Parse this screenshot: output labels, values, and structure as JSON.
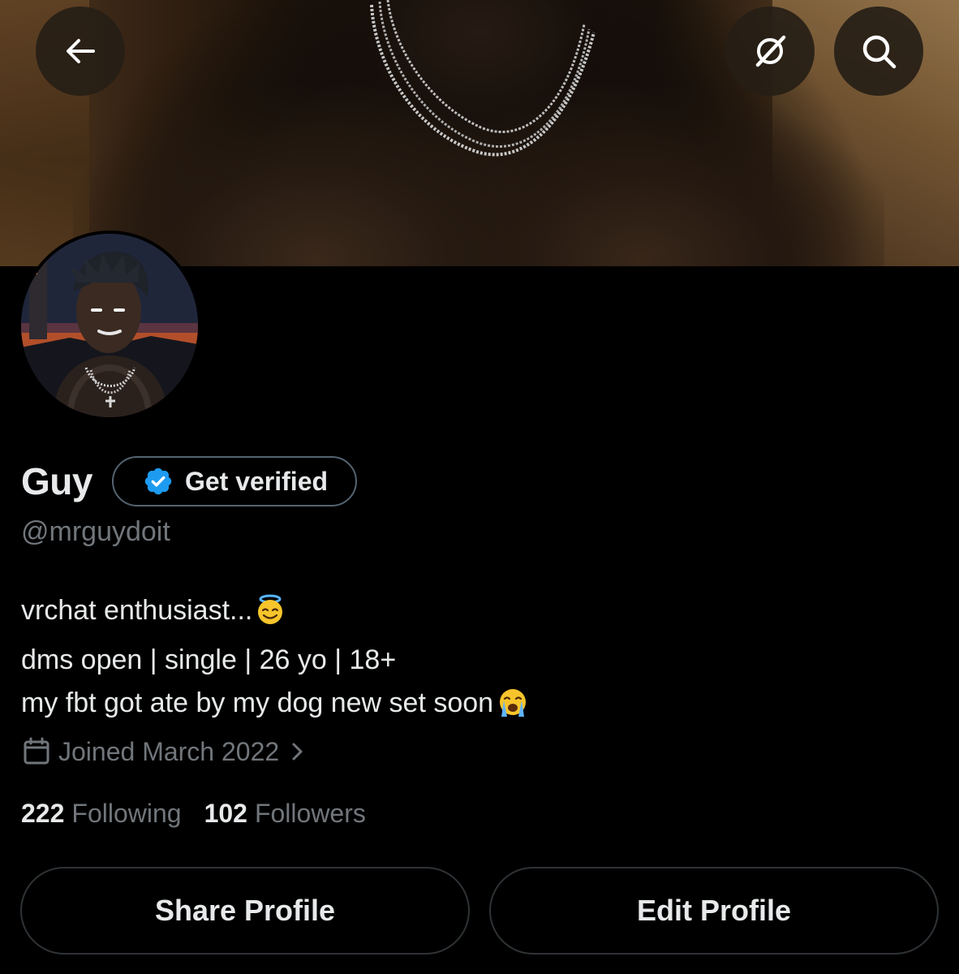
{
  "header": {
    "back_icon": "arrow-left-icon",
    "grok_icon": "grok-icon",
    "search_icon": "search-icon"
  },
  "profile": {
    "display_name": "Guy",
    "verify_label": "Get verified",
    "verify_icon": "verified-badge-icon",
    "handle": "@mrguydoit",
    "bio": [
      {
        "text": "vrchat enthusiast...",
        "emoji": "smiling-face-with-halo"
      },
      {
        "text": "dms open | single | 26 yo | 18+",
        "emoji": null
      },
      {
        "text": "my fbt got ate by my dog new set soon",
        "emoji": "loudly-crying-face"
      }
    ],
    "joined_text": "Joined March 2022",
    "following_count": "222",
    "following_label": "Following",
    "followers_count": "102",
    "followers_label": "Followers"
  },
  "actions": {
    "share_label": "Share Profile",
    "edit_label": "Edit Profile"
  },
  "colors": {
    "background": "#000000",
    "primary_text": "#e7e9ea",
    "secondary_text": "#71767b",
    "verified_blue": "#1d9bf0",
    "border": "#2f3336",
    "button_overlay": "#261e16"
  }
}
